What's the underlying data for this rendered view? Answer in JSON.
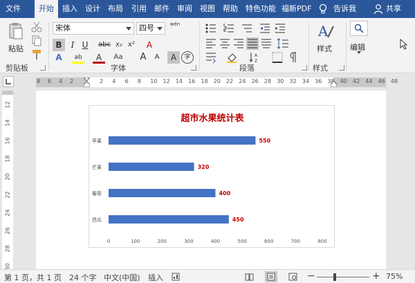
{
  "ribbon_tabs": [
    "文件",
    "开始",
    "插入",
    "设计",
    "布局",
    "引用",
    "邮件",
    "审阅",
    "视图",
    "帮助",
    "特色功能",
    "福新PDF",
    "告诉我",
    "共享"
  ],
  "clipboard": {
    "paste": "粘贴",
    "group": "剪贴板"
  },
  "font": {
    "name": "宋体",
    "size": "四号",
    "group": "字体",
    "pinyin": "wén",
    "bold": "B",
    "italic": "I",
    "underline": "U",
    "strike": "abc",
    "sub": "x₂",
    "sup": "x²",
    "color_a": "A",
    "highlight": "ab",
    "aa": "Aa",
    "grow": "A",
    "shrink": "A",
    "phonetic": "A",
    "enclose": "字",
    "clear": "A"
  },
  "paragraph": {
    "group": "段落"
  },
  "styles": {
    "label": "样式",
    "group": "样式"
  },
  "editing": {
    "label": "编辑"
  },
  "ruler": {
    "left_marks": [
      "8",
      "6",
      "4",
      "2"
    ],
    "right_marks": [
      "2",
      "4",
      "6",
      "8",
      "10",
      "12",
      "14",
      "16",
      "18",
      "20",
      "22",
      "24",
      "26",
      "28",
      "30",
      "32",
      "34",
      "36",
      "38",
      "40",
      "42",
      "44",
      "46",
      "48"
    ],
    "vertical_marks": [
      "12",
      "14",
      "16",
      "18",
      "20",
      "22",
      "24",
      "26",
      "28",
      "30"
    ]
  },
  "chart_data": {
    "type": "bar",
    "title": "超市水果统计表",
    "categories": [
      "苹果",
      "芒果",
      "葡萄",
      "西瓜"
    ],
    "values": [
      550,
      320,
      400,
      450
    ],
    "xlim": [
      0,
      800
    ],
    "x_ticks": [
      "0",
      "100",
      "200",
      "300",
      "400",
      "500",
      "600",
      "700",
      "800"
    ],
    "orientation": "horizontal",
    "bar_color": "#4472c4",
    "label_color": "#c00000",
    "grid": false
  },
  "status": {
    "page": "第 1 页，共 1 页",
    "words": "24 个字",
    "language": "中文(中国)",
    "mode": "插入",
    "zoom": "75%"
  },
  "colors": {
    "accent": "#2b579a",
    "label": "#c00000"
  }
}
